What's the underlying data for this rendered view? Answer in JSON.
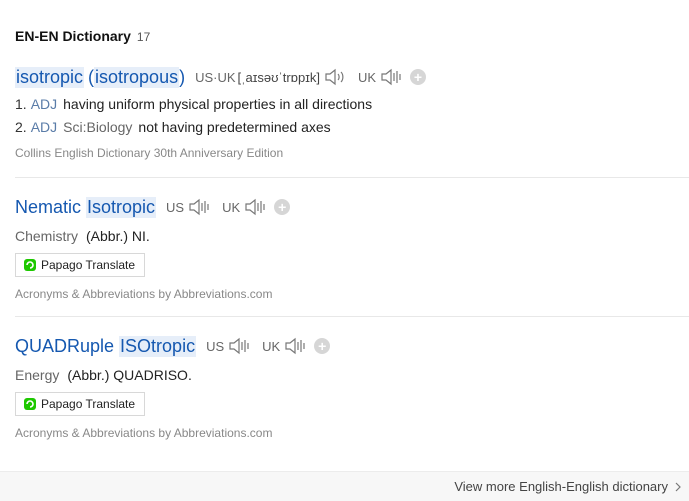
{
  "header": {
    "title": "EN-EN Dictionary",
    "count": "17"
  },
  "entries": [
    {
      "headword": "isotropic",
      "headword_extra_open": "( ",
      "headword_extra": "isotropous",
      "headword_extra_close": " )",
      "us_label": "US",
      "uk_label": "UK",
      "phonetic_prefix": "US·UK",
      "phonetic": "[ˌaɪsəʊˈtrɒpɪk]",
      "senses": [
        {
          "num": "1.",
          "pos": "ADJ",
          "field": "",
          "text": "having uniform physical properties in all directions"
        },
        {
          "num": "2.",
          "pos": "ADJ",
          "field": "Sci:Biology",
          "text": "not having predetermined axes"
        }
      ],
      "source": "Collins English Dictionary 30th Anniversary Edition"
    },
    {
      "headword_part1": "Nematic",
      "headword_part2": "Isotropic",
      "us_label": "US",
      "uk_label": "UK",
      "category": "Chemistry",
      "text": "(Abbr.) NI.",
      "button": "Papago Translate",
      "source": "Acronyms & Abbreviations by Abbreviations.com"
    },
    {
      "headword_part1": "QUADRuple",
      "headword_part2": "ISOtropic",
      "us_label": "US",
      "uk_label": "UK",
      "category": "Energy",
      "text": "(Abbr.) QUADRISO.",
      "button": "Papago Translate",
      "source": "Acronyms & Abbreviations by Abbreviations.com"
    }
  ],
  "footer": {
    "view_more": "View more English-English dictionary"
  },
  "colors": {
    "headword": "#1558b0",
    "highlight": "#e6eef9",
    "pos": "#5a7ca8",
    "papago_green": "#1ec800"
  }
}
